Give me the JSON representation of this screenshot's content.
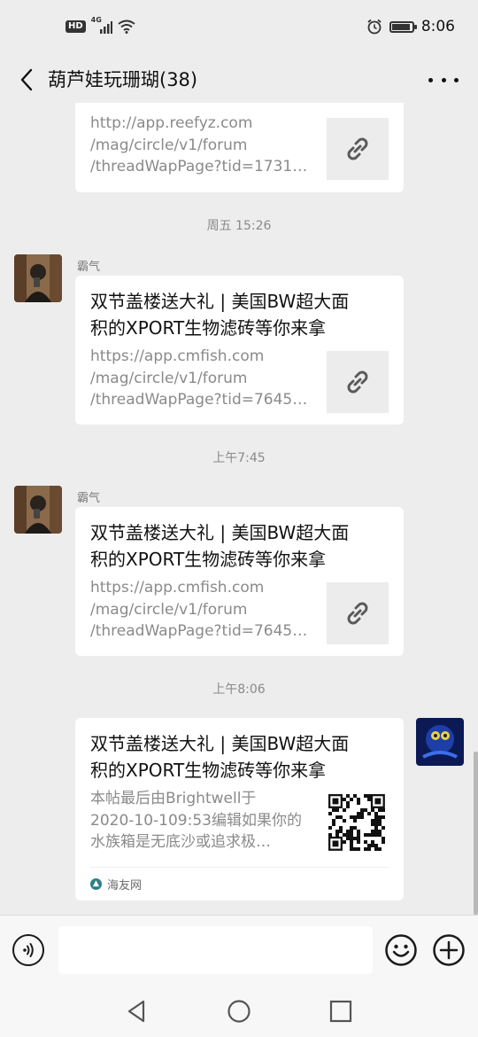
{
  "status_bar": {
    "network_badge": "HD",
    "network_type": "4G",
    "time": "8:06",
    "battery_level": 0.9
  },
  "header": {
    "title": "葫芦娃玩珊瑚(38)",
    "back_icon": "chevron-left-icon",
    "more_icon": "more-horizontal-icon"
  },
  "messages": [
    {
      "type": "link-card",
      "sender": "",
      "desc_lines": [
        "http://app.reefyz.com",
        "/mag/circle/v1/forum",
        "/threadWapPage?tid=1731…"
      ],
      "thumb_icon": "link-icon"
    },
    {
      "type": "time",
      "text": "周五 15:26"
    },
    {
      "type": "link-card",
      "sender": "霸气",
      "title_lines": [
        "双节盖楼送大礼 | 美国BW超大面",
        "积的XPORT生物滤砖等你来拿"
      ],
      "desc_lines": [
        "https://app.cmfish.com",
        "/mag/circle/v1/forum",
        "/threadWapPage?tid=7645…"
      ],
      "thumb_icon": "link-icon"
    },
    {
      "type": "time",
      "text": "上午7:45"
    },
    {
      "type": "link-card",
      "sender": "霸气",
      "title_lines": [
        "双节盖楼送大礼 | 美国BW超大面",
        "积的XPORT生物滤砖等你来拿"
      ],
      "desc_lines": [
        "https://app.cmfish.com",
        "/mag/circle/v1/forum",
        "/threadWapPage?tid=7645…"
      ],
      "thumb_icon": "link-icon"
    },
    {
      "type": "time",
      "text": "上午8:06"
    },
    {
      "type": "app-card",
      "sender": "self",
      "title_lines": [
        "双节盖楼送大礼 | 美国BW超大面",
        "积的XPORT生物滤砖等你来拿"
      ],
      "desc_lines": [
        "本帖最后由Brightwell于",
        "2020-10-109:53编辑如果你的",
        "水族箱是无底沙或追求极…"
      ],
      "thumb_icon": "qr-code-icon",
      "source": "海友网"
    }
  ],
  "input_bar": {
    "voice_icon": "voice-icon",
    "placeholder": "",
    "emoji_icon": "emoji-icon",
    "plus_icon": "plus-circle-icon"
  },
  "nav_bar": {
    "back_icon": "nav-back-icon",
    "home_icon": "nav-home-icon",
    "recents_icon": "nav-recents-icon"
  }
}
